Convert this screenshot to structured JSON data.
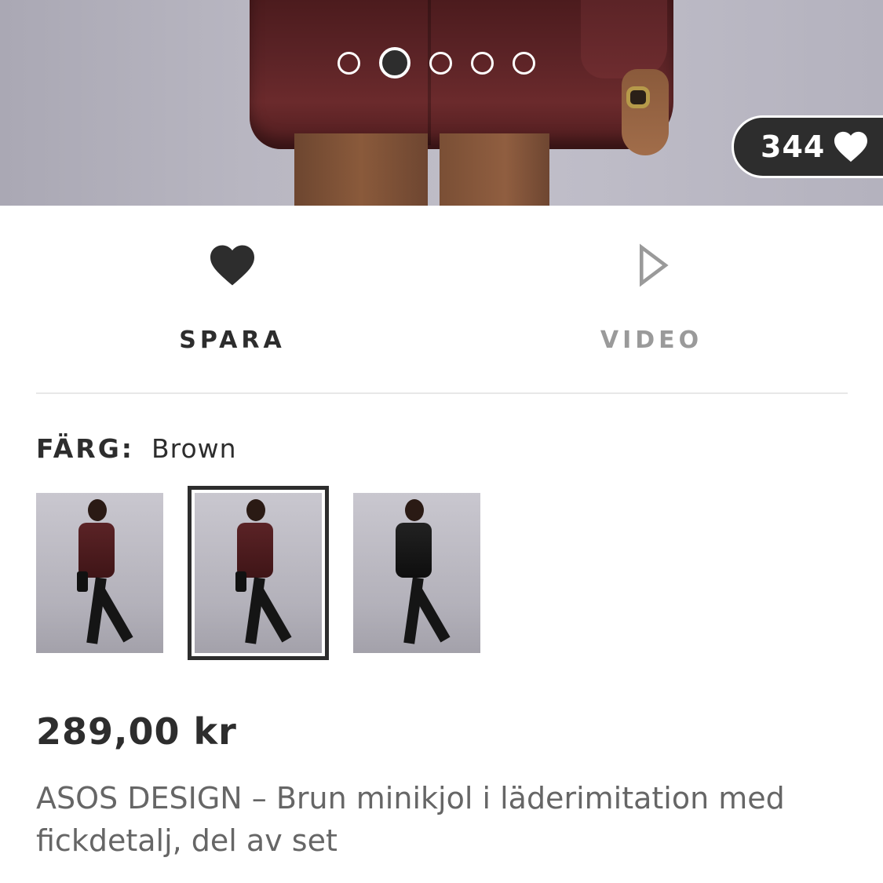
{
  "hero": {
    "carousel": {
      "count": 5,
      "active_index": 1
    },
    "likes_count": "344"
  },
  "actions": {
    "save_label": "SPARA",
    "video_label": "VIDEO"
  },
  "colour": {
    "label": "FÄRG:",
    "value": "Brown",
    "swatches": [
      {
        "name": "Brown",
        "selected": false
      },
      {
        "name": "Brown",
        "selected": true
      },
      {
        "name": "Black",
        "selected": false
      }
    ]
  },
  "product": {
    "price": "289,00 kr",
    "title": "ASOS DESIGN – Brun minikjol i läderimitation med fickdetalj, del av set"
  },
  "colors": {
    "text_primary": "#2d2d2d",
    "text_muted": "#666666",
    "inactive": "#9a9a9a",
    "divider": "#e8e8e8"
  }
}
